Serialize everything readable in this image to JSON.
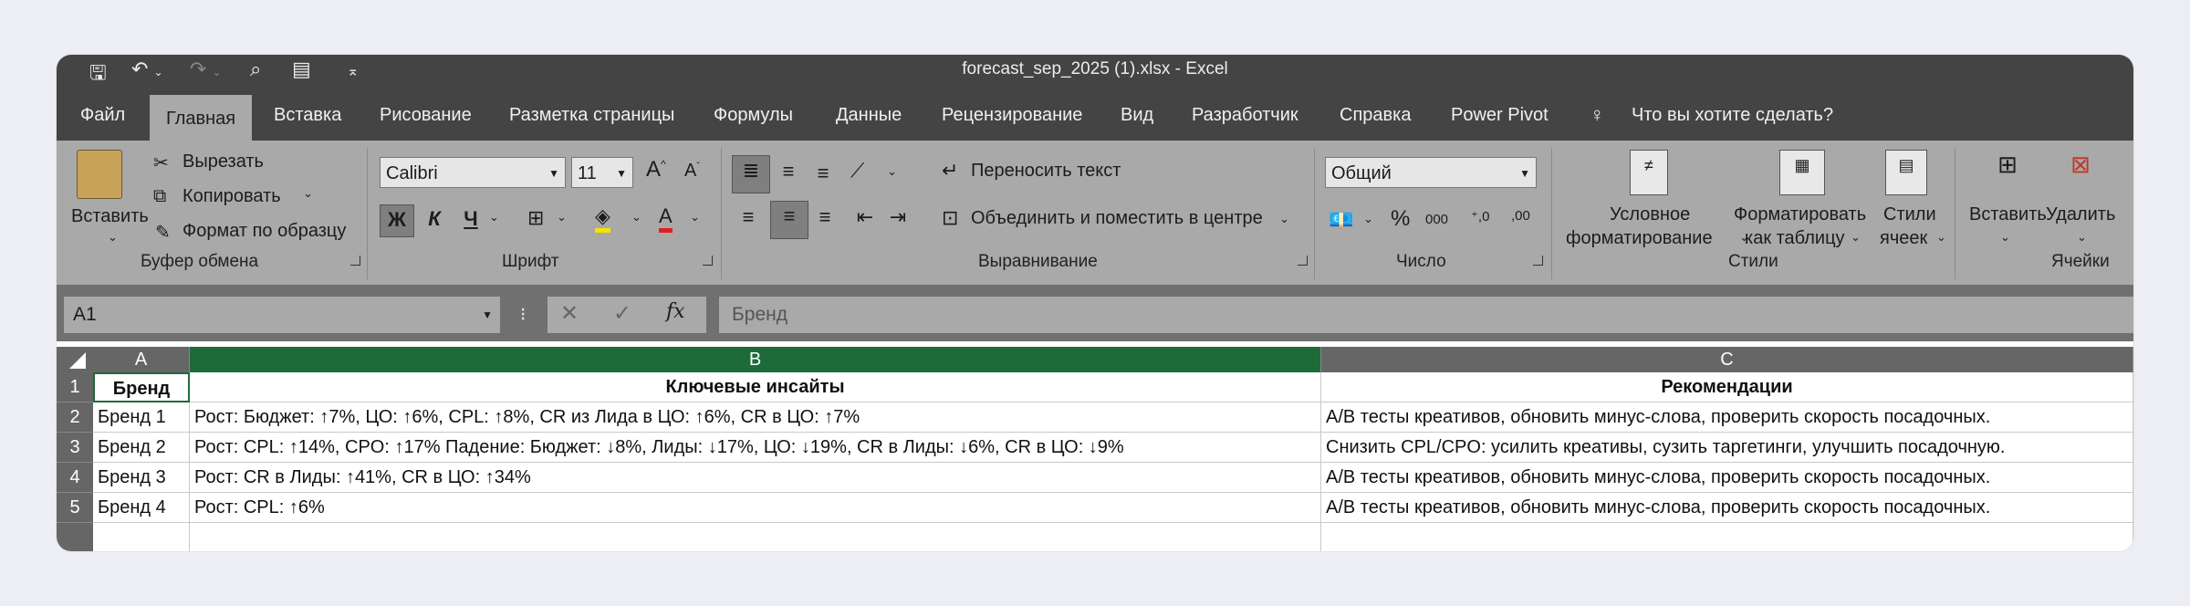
{
  "window": {
    "title": "forecast_sep_2025 (1).xlsx  -  Excel"
  },
  "quick_access": {
    "save_icon": "save-icon",
    "undo_icon": "undo-icon",
    "redo_icon": "redo-icon",
    "search_icon": "search-icon",
    "customize_icon": "customize-icon"
  },
  "menu": {
    "items": [
      "Файл",
      "Главная",
      "Вставка",
      "Рисование",
      "Разметка страницы",
      "Формулы",
      "Данные",
      "Рецензирование",
      "Вид",
      "Разработчик",
      "Справка",
      "Power Pivot"
    ],
    "active": "Главная",
    "tell_me": "Что вы хотите сделать?"
  },
  "ribbon": {
    "clipboard": {
      "paste": "Вставить",
      "cut": "Вырезать",
      "copy": "Копировать",
      "format_painter": "Формат по образцу",
      "label": "Буфер обмена"
    },
    "font": {
      "name": "Calibri",
      "size": "11",
      "bold": "Ж",
      "italic": "К",
      "underline": "Ч",
      "label": "Шрифт"
    },
    "alignment": {
      "wrap": "Переносить текст",
      "merge": "Объединить и поместить в центре",
      "label": "Выравнивание"
    },
    "number": {
      "format": "Общий",
      "label": "Число"
    },
    "styles": {
      "conditional_1": "Условное",
      "conditional_2": "форматирование",
      "table_1": "Форматировать",
      "table_2": "как таблицу",
      "cell_1": "Стили",
      "cell_2": "ячеек",
      "label": "Стили"
    },
    "cells": {
      "insert": "Вставить",
      "delete": "Удалить",
      "label": "Ячейки"
    }
  },
  "formula_bar": {
    "name_box": "A1",
    "content": "Бренд"
  },
  "sheet": {
    "columns": [
      "A",
      "B",
      "C"
    ],
    "rows": [
      {
        "n": "1",
        "a": "Бренд",
        "b": "Ключевые инсайты",
        "c": "Рекомендации"
      },
      {
        "n": "2",
        "a": "Бренд 1",
        "b": "Рост: Бюджет: ↑7%, ЦО: ↑6%, CPL: ↑8%, CR из Лида в ЦО: ↑6%, CR в ЦО: ↑7%",
        "c": "A/B тесты креативов, обновить минус-слова, проверить скорость посадочных."
      },
      {
        "n": "3",
        "a": "Бренд 2",
        "b": "Рост: CPL: ↑14%, CPO: ↑17% Падение: Бюджет: ↓8%, Лиды: ↓17%, ЦО: ↓19%, CR в Лиды: ↓6%, CR в ЦО: ↓9%",
        "c": "Снизить CPL/CPO: усилить креативы, сузить таргетинги, улучшить посадочную."
      },
      {
        "n": "4",
        "a": "Бренд 3",
        "b": "Рост: CR в Лиды: ↑41%, CR в ЦО: ↑34%",
        "c": "A/B тесты креативов, обновить минус-слова, проверить скорость посадочных."
      },
      {
        "n": "5",
        "a": "Бренд 4",
        "b": "Рост: CPL: ↑6%",
        "c": "A/B тесты креативов, обновить минус-слова, проверить скорость посадочных."
      }
    ]
  }
}
